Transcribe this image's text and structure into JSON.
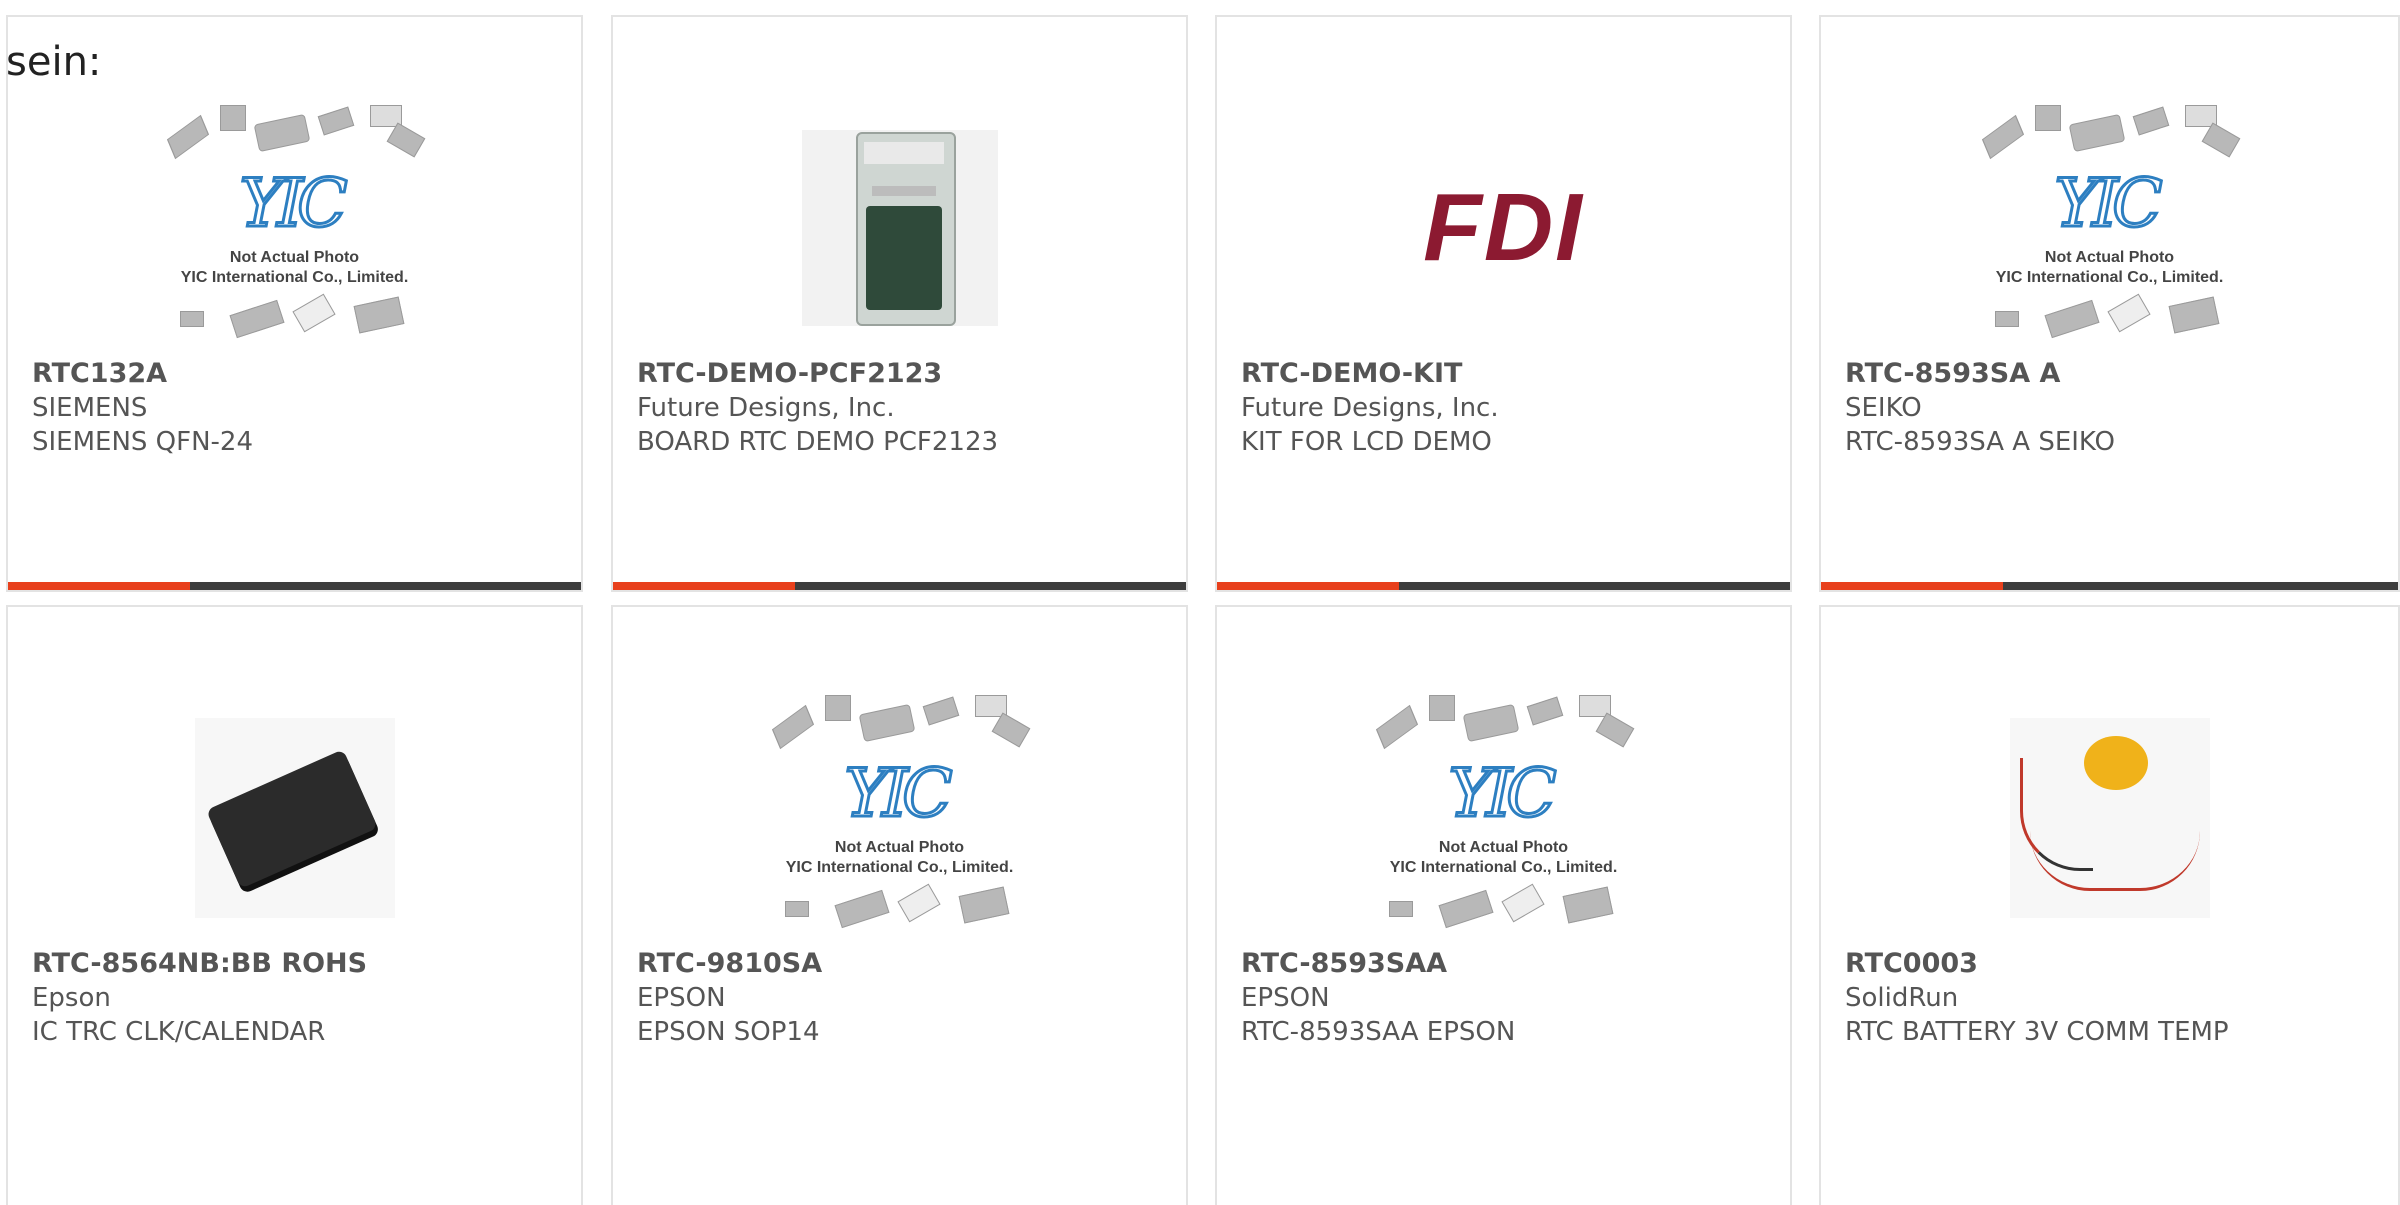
{
  "page": {
    "prefix_text": "sein:"
  },
  "colors": {
    "accent": "#e8401c",
    "bar_dark": "#3d3d3d",
    "card_border": "#e3e3e3",
    "text_gray": "#555555",
    "fdi_brand": "#8c1a31",
    "yic_blue": "#2d7fc1"
  },
  "placeholder": {
    "logo": "YIC",
    "note_line1": "Not Actual Photo",
    "note_line2": "YIC International Co., Limited."
  },
  "products": [
    {
      "part": "RTC132A",
      "manufacturer": "SIEMENS",
      "description": "SIEMENS QFN-24",
      "image": "yic-placeholder"
    },
    {
      "part": "RTC-DEMO-PCF2123",
      "manufacturer": "Future Designs, Inc.",
      "description": "BOARD RTC DEMO PCF2123",
      "image": "fdi-board-package"
    },
    {
      "part": "RTC-DEMO-KIT",
      "manufacturer": "Future Designs, Inc.",
      "description": "KIT FOR LCD DEMO",
      "image": "fdi-logo",
      "logo_text": "FDI"
    },
    {
      "part": "RTC-8593SA A",
      "manufacturer": "SEIKO",
      "description": "RTC-8593SA A SEIKO",
      "image": "yic-placeholder"
    },
    {
      "part": "RTC-8564NB:BB ROHS",
      "manufacturer": "Epson",
      "description": "IC TRC CLK/CALENDAR",
      "image": "ic-chip-photo"
    },
    {
      "part": "RTC-9810SA",
      "manufacturer": "EPSON",
      "description": "EPSON SOP14",
      "image": "yic-placeholder"
    },
    {
      "part": "RTC-8593SAA",
      "manufacturer": "EPSON",
      "description": "RTC-8593SAA EPSON",
      "image": "yic-placeholder"
    },
    {
      "part": "RTC0003",
      "manufacturer": "SolidRun",
      "description": "RTC BATTERY 3V COMM TEMP",
      "image": "coin-battery-photo"
    }
  ]
}
